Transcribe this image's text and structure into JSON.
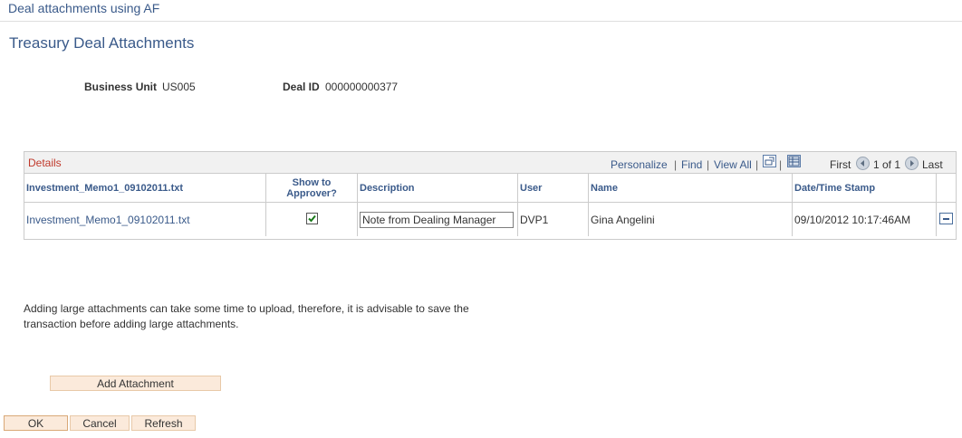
{
  "header": {
    "title": "Deal attachments using AF"
  },
  "page": {
    "title": "Treasury Deal Attachments"
  },
  "fields": {
    "business_unit_label": "Business Unit",
    "business_unit_value": "US005",
    "deal_id_label": "Deal ID",
    "deal_id_value": "000000000377"
  },
  "grid": {
    "title": "Details",
    "nav": {
      "personalize": "Personalize",
      "find": "Find",
      "view_all": "View All",
      "first": "First",
      "count": "1 of 1",
      "last": "Last"
    },
    "columns": [
      "Investment_Memo1_09102011.txt",
      "Show to Approver?",
      "Description",
      "User",
      "Name",
      "Date/Time Stamp"
    ],
    "rows": [
      {
        "file": "Investment_Memo1_09102011.txt",
        "show_to_approver": true,
        "description": "Note from Dealing Manager",
        "user": "DVP1",
        "name": "Gina Angelini",
        "timestamp": "09/10/2012 10:17:46AM"
      }
    ]
  },
  "note": "Adding large attachments can take some time to upload, therefore, it is advisable to save the transaction before adding large attachments.",
  "buttons": {
    "add_attachment": "Add Attachment",
    "ok": "OK",
    "cancel": "Cancel",
    "refresh": "Refresh"
  },
  "colors": {
    "link": "#3a5a8a",
    "grid_title": "#c0392b",
    "button_bg": "#fbeadb"
  }
}
